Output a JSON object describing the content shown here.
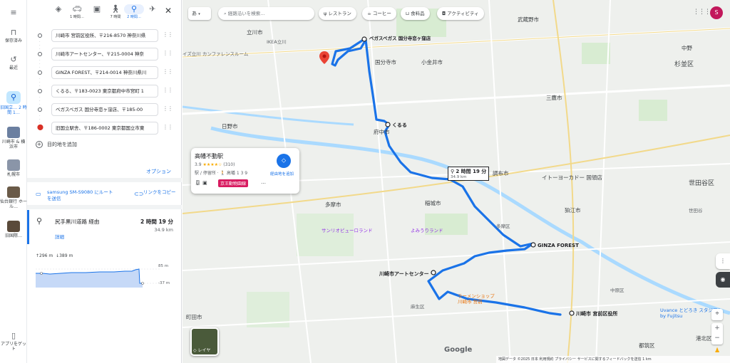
{
  "rail": {
    "items": [
      {
        "label": "保存済み"
      },
      {
        "label": "最近"
      },
      {
        "label": "旧国立… 2 時間 1…"
      },
      {
        "label": "川崎市 & 横浜市"
      },
      {
        "label": "札幌市"
      },
      {
        "label": "仙台銀行 ホール…"
      },
      {
        "label": "旧国際…"
      }
    ],
    "app_get": "アプリをゲット"
  },
  "modes": [
    {
      "icon": "directions-icon",
      "label": ""
    },
    {
      "icon": "car-icon",
      "label": "1 時間…"
    },
    {
      "icon": "transit-icon",
      "label": ""
    },
    {
      "icon": "walk-icon",
      "label": "7 時間"
    },
    {
      "icon": "bike-icon",
      "label": "2 時間…"
    },
    {
      "icon": "flight-icon",
      "label": ""
    }
  ],
  "stops": [
    {
      "text": "川崎市 宮前区役所、〒216-8570 神奈川県"
    },
    {
      "text": "川崎市アートセンター、〒215-0004 神奈"
    },
    {
      "text": "GINZA FOREST、〒214-0014 神奈川県川"
    },
    {
      "text": "くるる、〒183-0023 東京都府中市宮町 1"
    },
    {
      "text": "ベガスベガス 国分寺恋ヶ窪店、〒185-00"
    },
    {
      "text": "旧国立駅舎、〒186-0002 東京都国立市東"
    }
  ],
  "add_destination": "目的地を追加",
  "options": "オプション",
  "send_phone": "samsung SM-S9080 にルートを送信",
  "copy_link": "リンクをコピー",
  "route": {
    "via": "尻手黒川道路 経由",
    "duration": "2 時間 19 分",
    "distance": "34.9 km",
    "detail": "詳細"
  },
  "elevation": {
    "up": "296 m",
    "down": "389 m",
    "max": "85 m",
    "min": "-37 m"
  },
  "map": {
    "lang": "あ",
    "search_placeholder": "経路沿いを検索...",
    "chips": [
      "レストラン",
      "コーヒー",
      "食料品",
      "アクティビティ"
    ],
    "avatar": "S",
    "popup": {
      "name": "高幡不動駅",
      "rating": "3.9",
      "stars": "★★★★☆",
      "count": "(310)",
      "category": "駅 / 停留所 · 🚶 高幡 1 3 9",
      "line": "京王動物園線",
      "waypoint_label": "経由地を追加"
    },
    "duration_box": {
      "duration": "2 時間 19 分",
      "distance": "34.9 km"
    },
    "waypoint_labels": [
      "ベガスベガス 国分寺恋ヶ窪店",
      "くるる",
      "GINZA FOREST",
      "川崎市アートセンター",
      "川崎市 宮前区役所"
    ],
    "labels": {
      "tachikawa": "立川市",
      "ikea": "IKEA立川",
      "conran": "イズ立川 カンファレンスルーム",
      "kokubunji": "国分寺市",
      "koganei": "小金井市",
      "musashino": "武蔵野市",
      "nakano": "中野",
      "suginami": "杉並区",
      "mitaka": "三鷹市",
      "hino": "日野市",
      "fuchu": "府中市",
      "chofu": "調布市",
      "setagaya": "世田谷区",
      "inagi": "稲城市",
      "tama": "多摩市",
      "komae": "狛江市",
      "machida": "町田市",
      "asao": "麻生区",
      "sanrio": "サンリオピューロランド",
      "yomiuri": "よみうりランド",
      "tamaku": "多摩区",
      "kohoku": "港北区",
      "tsuzuki": "都筑区",
      "yonekura": "世田谷",
      "nakahara": "中原区",
      "uvance": "Uvance とどろき スタジアム by Fujitsu",
      "ito": "イトーヨーカドー 国領店",
      "ramen": "ラーメンショップ 川崎市 宮前"
    },
    "layers": "レイヤ",
    "google": "Google",
    "attribution": "地図データ ©2025 日本 利用規約 プライバシー サービスに関するフィードバックを送信 1 km"
  }
}
